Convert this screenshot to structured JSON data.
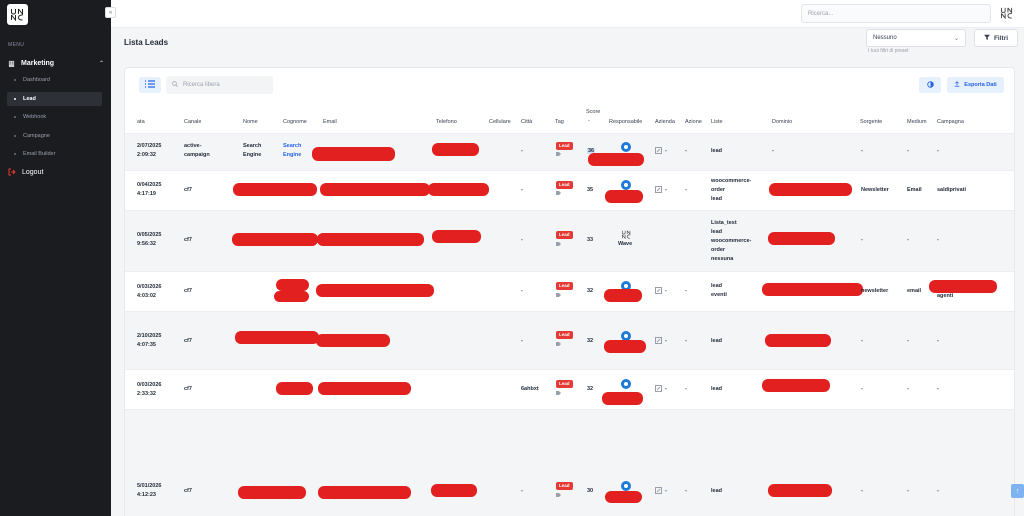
{
  "sidebar": {
    "menu_label": "MENU",
    "group_label": "Marketing",
    "items": [
      {
        "label": "Dashboard"
      },
      {
        "label": "Lead"
      },
      {
        "label": "Webhook"
      },
      {
        "label": "Campagne"
      },
      {
        "label": "Email Builder"
      }
    ],
    "logout_label": "Logout"
  },
  "topbar": {
    "search_placeholder": "Ricerca..."
  },
  "page": {
    "title": "Lista Leads",
    "preset_value": "Nessuno",
    "preset_hint": "I tuoi filtri di preset",
    "filter_label": "Filtri",
    "search_placeholder": "Ricerca libera",
    "export_label": "Esporta Dati"
  },
  "table": {
    "headers": [
      "ata",
      "Canale",
      "Nome",
      "Cognome",
      "Email",
      "Telefono",
      "Cellulare",
      "Città",
      "Tag",
      "Score",
      "Responsabile",
      "Azienda",
      "Azione",
      "Liste",
      "Dominio",
      "Sorgente",
      "Medium",
      "Campagna"
    ],
    "score_sort": "-",
    "rows": [
      {
        "date": "2/07/2025",
        "time": "2:09:32",
        "canale": [
          "active-",
          "campaign"
        ],
        "nome": [
          "Search",
          "Engine"
        ],
        "cognome": [
          "Search",
          "Engine"
        ],
        "citta": "-",
        "tag": "Lead",
        "score": "36",
        "azienda": "-",
        "azione": "-",
        "liste": [
          "lead"
        ],
        "dominio": "-",
        "sorgente": "-",
        "medium": "-",
        "campagna": "-"
      },
      {
        "date": "0/04/2025",
        "time": "4:17:19",
        "canale": [
          "cf7"
        ],
        "citta": "-",
        "tag": "Lead",
        "score": "35",
        "azienda": "-",
        "azione": "-",
        "liste": [
          "woocommerce-",
          "order",
          "lead"
        ],
        "sorgente": "Newsletter",
        "medium": "Email",
        "campagna": "saldiprivati"
      },
      {
        "date": "0/05/2025",
        "time": "9:56:32",
        "canale": [
          "cf7"
        ],
        "citta": "-",
        "tag": "Lead",
        "score": "33",
        "responsabile": "Wave",
        "liste": [
          "Lista_test",
          "lead",
          "woocommerce-",
          "order",
          "nessuna"
        ],
        "sorgente": "-",
        "medium": "-",
        "campagna": "-"
      },
      {
        "date": "0/03/2026",
        "time": "4:03:02",
        "canale": [
          "cf7"
        ],
        "citta": "-",
        "tag": "Lead",
        "score": "32",
        "azienda": "-",
        "azione": "-",
        "liste": [
          "lead",
          "eventi"
        ],
        "sorgente": "newsletter",
        "medium": "email",
        "campagna": "agenti"
      },
      {
        "date": "2/10/2025",
        "time": "4:07:35",
        "canale": [
          "cf7"
        ],
        "citta": "-",
        "tag": "Lead",
        "score": "32",
        "azienda": "-",
        "azione": "-",
        "liste": [
          "lead"
        ],
        "sorgente": "-",
        "medium": "-",
        "campagna": "-"
      },
      {
        "date": "0/03/2026",
        "time": "2:33:32",
        "canale": [
          "cf7"
        ],
        "citta": "6ahbxt",
        "tag": "Lead",
        "score": "32",
        "azienda": "-",
        "azione": "-",
        "liste": [
          "lead"
        ],
        "sorgente": "-",
        "medium": "-",
        "campagna": "-"
      },
      {
        "date": "5/01/2026",
        "time": "4:12:23",
        "canale": [
          "cf7"
        ],
        "citta": "-",
        "tag": "Lead",
        "score": "30",
        "azienda": "-",
        "azione": "-",
        "liste": [
          "lead"
        ],
        "sorgente": "-",
        "medium": "-",
        "campagna": "-"
      }
    ]
  },
  "colors": {
    "accent": "#2563eb",
    "tag": "#e53935",
    "sidebar": "#1a1c20"
  }
}
